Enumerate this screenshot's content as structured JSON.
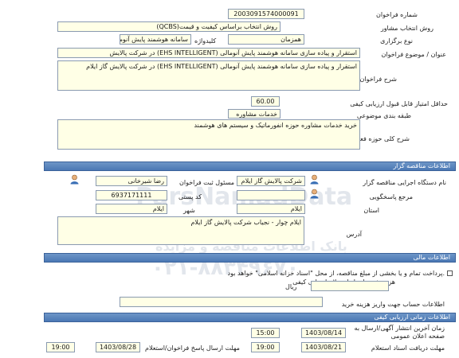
{
  "general": {
    "tender_number_label": "شماره فراخوان",
    "tender_number": "2003091574000091",
    "selection_method_label": "روش انتخاب مشاور",
    "selection_method": "روش انتخاب براساس کیفیت و قیمت(QCBS)",
    "holding_type_label": "نوع برگزاری",
    "holding_type": "همزمان",
    "keyword_label": "کلیدواژه",
    "keyword": "سامانه هوشمند پایش آنومالی",
    "title_label": "عنوان / موضوع فراخوان",
    "title": "استقرار و پیاده سازی سامانه هوشمند پایش آنومالی (EHS INTELLIGENT) در شرکت پالایش",
    "description_label": "شرح فراخوان",
    "description": "استقرار و پیاده سازی سامانه هوشمند پایش آنومالی (EHS INTELLIGENT) در شرکت پالایش گاز ایلام",
    "min_score_label": "حداقل امتیاز قابل قبول ارزیابی کیفی",
    "min_score": "60.00",
    "category_label": "طبقه بندی موضوعی",
    "category": "خدمات مشاوره",
    "activity_label": "شرح کلی حوزه فعالیت",
    "activity": "خرید خدمات مشاوره حوزه انفورماتیک و سیستم های هوشمند"
  },
  "organizer": {
    "section_title": "اطلاعات مناقصه گزار",
    "org_name_label": "نام دستگاه اجرایی مناقصه گزار",
    "org_name": "شرکت پالایش گاز ایلام",
    "responsible_label": "مسئول ثبت فراخوان",
    "responsible": "رضا شیرخانی",
    "reference_label": "مرجع پاسخگویی",
    "postal_label": "کد پستی",
    "postal_code": "6937171111",
    "province_label": "استان",
    "province": "ایلام",
    "city_label": "شهر",
    "city": "ایلام",
    "address_label": "آدرس",
    "address": "ایلام چوار - نجیاب شرکت پالایش گاز ایلام"
  },
  "financial": {
    "section_title": "اطلاعات مالی",
    "payment_note": "پرداخت تمام و یا بخشی از مبلغ مناقصه، از محل \"اسناد خزانه اسلامی\" خواهد بود.",
    "doc_fee_label": "هزینه خرید اسناد استعلام ارزیابی کیفی",
    "currency": "ریال",
    "account_label": "اطلاعات حساب جهت واریز هزینه خرید"
  },
  "timing": {
    "section_title": "اطلاعات زمانی ارزیابی کیفی",
    "publish_label": "زمان آخرین انتشار آگهی/ارسال به صفحه اعلان عمومی",
    "publish_date": "1403/08/14",
    "publish_time": "15:00",
    "deadline_label": "مهلت دریافت اسناد استعلام",
    "deadline_date": "1403/08/21",
    "deadline_time": "19:00",
    "submit_label": "مهلت ارسال پاسخ فراخوان/استعلام",
    "submit_date": "1403/08/28",
    "submit_time": "19:00"
  },
  "watermark": {
    "line1": "پارس نماد داده",
    "line2": "بانک اطلاعات مناقصه و مزایده",
    "brand": "ParsNamadData",
    "phone": "۰۲۱-۸۸۳۴۹۶۷۰"
  },
  "colors": {
    "section_bar": "#4a77b4",
    "field_bg": "#ffffe6",
    "field_border": "#8a9ab0"
  }
}
